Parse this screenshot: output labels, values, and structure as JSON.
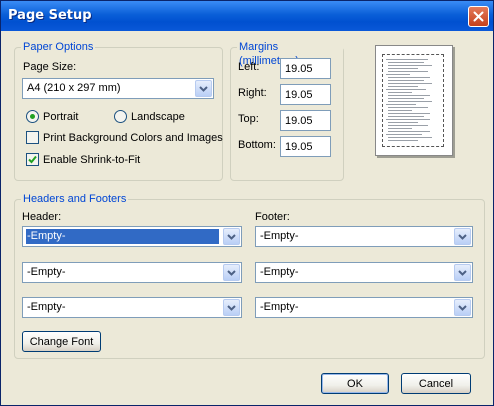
{
  "window": {
    "title": "Page Setup",
    "close_icon": "close-icon"
  },
  "paper_options": {
    "legend": "Paper Options",
    "page_size_label": "Page Size:",
    "page_size_value": "A4 (210 x 297 mm)",
    "portrait_label": "Portrait",
    "landscape_label": "Landscape",
    "orientation_selected": "Portrait",
    "print_background_label": "Print Background Colors and Images",
    "print_background_checked": false,
    "shrink_to_fit_label": "Enable Shrink-to-Fit",
    "shrink_to_fit_checked": true
  },
  "margins": {
    "legend": "Margins (millimeters)",
    "left_label": "Left:",
    "left_value": "19.05",
    "right_label": "Right:",
    "right_value": "19.05",
    "top_label": "Top:",
    "top_value": "19.05",
    "bottom_label": "Bottom:",
    "bottom_value": "19.05"
  },
  "headers_footers": {
    "legend": "Headers and Footers",
    "header_label": "Header:",
    "footer_label": "Footer:",
    "header_values": [
      "-Empty-",
      "-Empty-",
      "-Empty-"
    ],
    "footer_values": [
      "-Empty-",
      "-Empty-",
      "-Empty-"
    ],
    "change_font_label": "Change Font"
  },
  "buttons": {
    "ok_label": "OK",
    "cancel_label": "Cancel"
  },
  "colors": {
    "titlebar": "#0a5fd8",
    "dialog_bg": "#ece9d8",
    "legend_text": "#0046d5",
    "selection": "#316ac5"
  }
}
